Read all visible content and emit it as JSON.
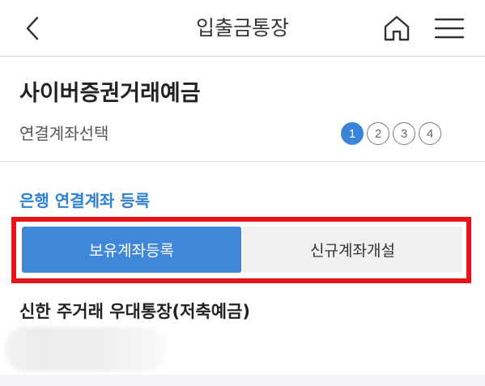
{
  "header": {
    "title": "입출금통장",
    "back_icon": "chevron-left-icon",
    "home_icon": "home-icon",
    "menu_icon": "hamburger-menu-icon"
  },
  "section": {
    "title": "사이버증권거래예금",
    "step_label": "연결계좌선택",
    "steps": [
      "1",
      "2",
      "3",
      "4"
    ],
    "current_step": 1
  },
  "bank_link": {
    "label": "은행 연결계좌 등록",
    "options": [
      {
        "label": "보유계좌등록",
        "selected": true
      },
      {
        "label": "신규계좌개설",
        "selected": false
      }
    ]
  },
  "product": {
    "name": "신한 주거래 우대통장(저축예금)"
  },
  "colors": {
    "accent": "#3e87d9",
    "link": "#2e82d6",
    "highlight": "#e8141b"
  }
}
